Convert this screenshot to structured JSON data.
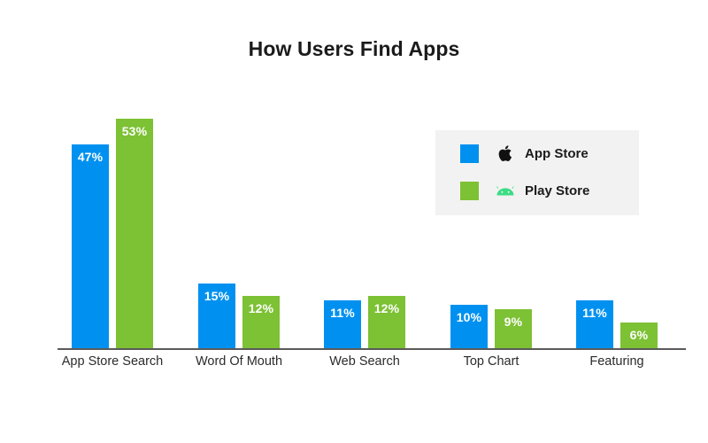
{
  "chart_data": {
    "type": "bar",
    "title": "How Users Find Apps",
    "xlabel": "",
    "ylabel": "",
    "ylim": [
      0,
      60
    ],
    "grid": false,
    "legend_position": "upper-right",
    "value_suffix": "%",
    "categories": [
      "App Store Search",
      "Word Of Mouth",
      "Web Search",
      "Top Chart",
      "Featuring"
    ],
    "series": [
      {
        "name": "App Store",
        "color": "#0091f0",
        "icon": "apple-logo-icon",
        "values": [
          47,
          15,
          11,
          10,
          11
        ],
        "labels": [
          "47%",
          "15%",
          "11%",
          "10%",
          "11%"
        ]
      },
      {
        "name": "Play Store",
        "color": "#7dc134",
        "icon": "android-robot-icon",
        "values": [
          53,
          12,
          12,
          9,
          6
        ],
        "labels": [
          "53%",
          "12%",
          "12%",
          "9%",
          "6%"
        ]
      }
    ]
  },
  "colors": {
    "app_store_blue": "#0091f0",
    "play_store_green": "#7dc134",
    "android_icon_green": "#3ddc84",
    "apple_icon_black": "#111111",
    "legend_background": "#f2f2f2",
    "axis_line": "#5a5a5a",
    "title_text": "#1b1b1b",
    "category_text": "#2b2b2b",
    "value_text": "#ffffff",
    "page_background": "#ffffff"
  },
  "legend": {
    "items": [
      {
        "label": "App Store",
        "color": "#0091f0",
        "icon": "apple-logo-icon"
      },
      {
        "label": "Play Store",
        "color": "#7dc134",
        "icon": "android-robot-icon"
      }
    ]
  }
}
